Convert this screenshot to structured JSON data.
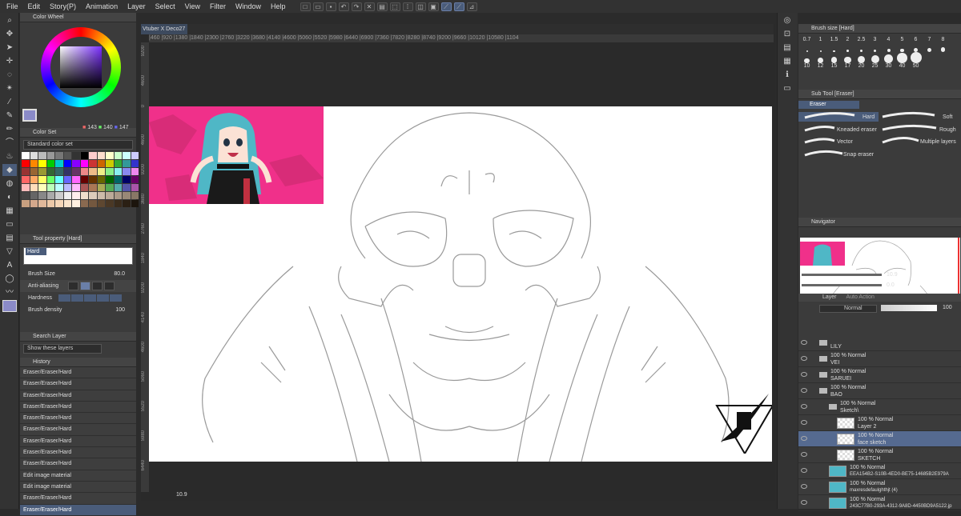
{
  "menu": [
    "File",
    "Edit",
    "Story(P)",
    "Animation",
    "Layer",
    "Select",
    "View",
    "Filter",
    "Window",
    "Help"
  ],
  "panels": {
    "color_wheel": "Color Wheel",
    "color_set": "Color Set",
    "color_set_select": "Standard color set",
    "tool_property": "Tool property [Hard]",
    "search_layer": "Search Layer",
    "show_layers": "Show these layers",
    "history": "History",
    "brush_size": "Brush size [Hard]",
    "sub_tool": "Sub Tool [Eraser]",
    "navigator": "Navigator",
    "layer": "Layer",
    "auto_action": "Auto Action"
  },
  "color_values": {
    "r": "143",
    "g": "140",
    "b": "147"
  },
  "tool_property": {
    "hard_label": "Hard",
    "brush_size_label": "Brush Size",
    "brush_size_value": "80.0",
    "anti_aliasing_label": "Anti-aliasing",
    "hardness_label": "Hardness",
    "brush_density_label": "Brush density",
    "brush_density_value": "100"
  },
  "history_items": [
    "Eraser/Eraser/Hard",
    "Eraser/Eraser/Hard",
    "Eraser/Eraser/Hard",
    "Eraser/Eraser/Hard",
    "Eraser/Eraser/Hard",
    "Eraser/Eraser/Hard",
    "Eraser/Eraser/Hard",
    "Eraser/Eraser/Hard",
    "Eraser/Eraser/Hard",
    "Edit image material",
    "Edit image material",
    "Eraser/Eraser/Hard",
    "Eraser/Eraser/Hard"
  ],
  "canvas": {
    "tab_title": "Vtuber X Deco27",
    "zoom": "10.9",
    "ruler_top": "|460 |920 |1380 |1840 |2300 |2760 |3220 |3680 |4140 |4600 |5060 |5520 |5980 |6440 |6900 |7360 |7820 |8280 |8740 |9200 |9660 |10120 |10580 |1104",
    "ruler_left": [
      "9200",
      "4600",
      "0",
      "4600",
      "9200",
      "3680",
      "2760",
      "1840",
      "9200",
      "4140",
      "4600",
      "5060",
      "5520",
      "5980",
      "6440"
    ]
  },
  "brush_sizes": [
    "0.7",
    "1",
    "1.5",
    "2",
    "2.5",
    "3",
    "4",
    "5",
    "6",
    "7",
    "8",
    "10",
    "12",
    "15",
    "17",
    "20",
    "25",
    "30",
    "40",
    "50"
  ],
  "sub_tool": {
    "eraser_label": "Eraser",
    "items": [
      "Hard",
      "Soft",
      "Kneaded eraser",
      "Rough",
      "Vector",
      "Multiple layers",
      "Snap eraser"
    ]
  },
  "navigator": {
    "zoom": "10.9",
    "rotation": "0.0"
  },
  "layer_panel": {
    "blend_mode": "Normal",
    "opacity": "100",
    "layers": [
      {
        "mode": "",
        "name": "LILY"
      },
      {
        "mode": "100 % Normal",
        "name": "VEI"
      },
      {
        "mode": "100 % Normal",
        "name": "SARUEI"
      },
      {
        "mode": "100 % Normal",
        "name": "BAO"
      },
      {
        "mode": "100 % Normal",
        "name": "Sketch\\"
      },
      {
        "mode": "100 % Normal",
        "name": "Layer 2"
      },
      {
        "mode": "100 % Normal",
        "name": "face sketch"
      },
      {
        "mode": "100 % Normal",
        "name": "SKETCH"
      },
      {
        "mode": "100 % Normal",
        "name": "EEA154B2-S10B-4ED0-BE75-14685B2E979A"
      },
      {
        "mode": "100 % Normal",
        "name": "maxresdefaulghthjt (4)"
      },
      {
        "mode": "100 % Normal",
        "name": "243C77B0-293A-4312-9A8D-4450BD9A5122.jp"
      }
    ]
  }
}
